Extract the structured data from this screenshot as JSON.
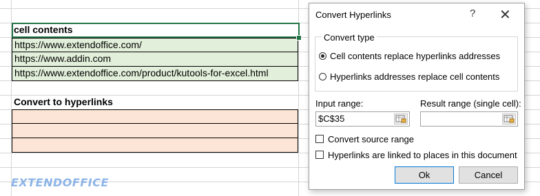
{
  "sheet": {
    "header": "cell contents",
    "urls": [
      "https://www.extendoffice.com/",
      "https://www.addin.com",
      "https://www.extendoffice.com/product/kutools-for-excel.html"
    ],
    "convert_header": "Convert to hyperlinks",
    "watermark": "EXTENDOFFICE"
  },
  "dialog": {
    "title": "Convert Hyperlinks",
    "help": "?",
    "close": "✕",
    "convert_type_label": "Convert type",
    "option1": "Cell contents replace hyperlinks addresses",
    "option2": "Hyperlinks addresses replace cell contents",
    "input_range_label": "Input range:",
    "input_range_value": "$C$35",
    "result_range_label": "Result range (single cell):",
    "result_range_value": "",
    "check1": "Convert source range",
    "check2": "Hyperlinks are linked to places in this document",
    "ok": "Ok",
    "cancel": "Cancel"
  },
  "colors": {
    "green_fill": "#e2efda",
    "peach_fill": "#fce4d6",
    "selection": "#217346",
    "default_button_border": "#0078d7"
  }
}
